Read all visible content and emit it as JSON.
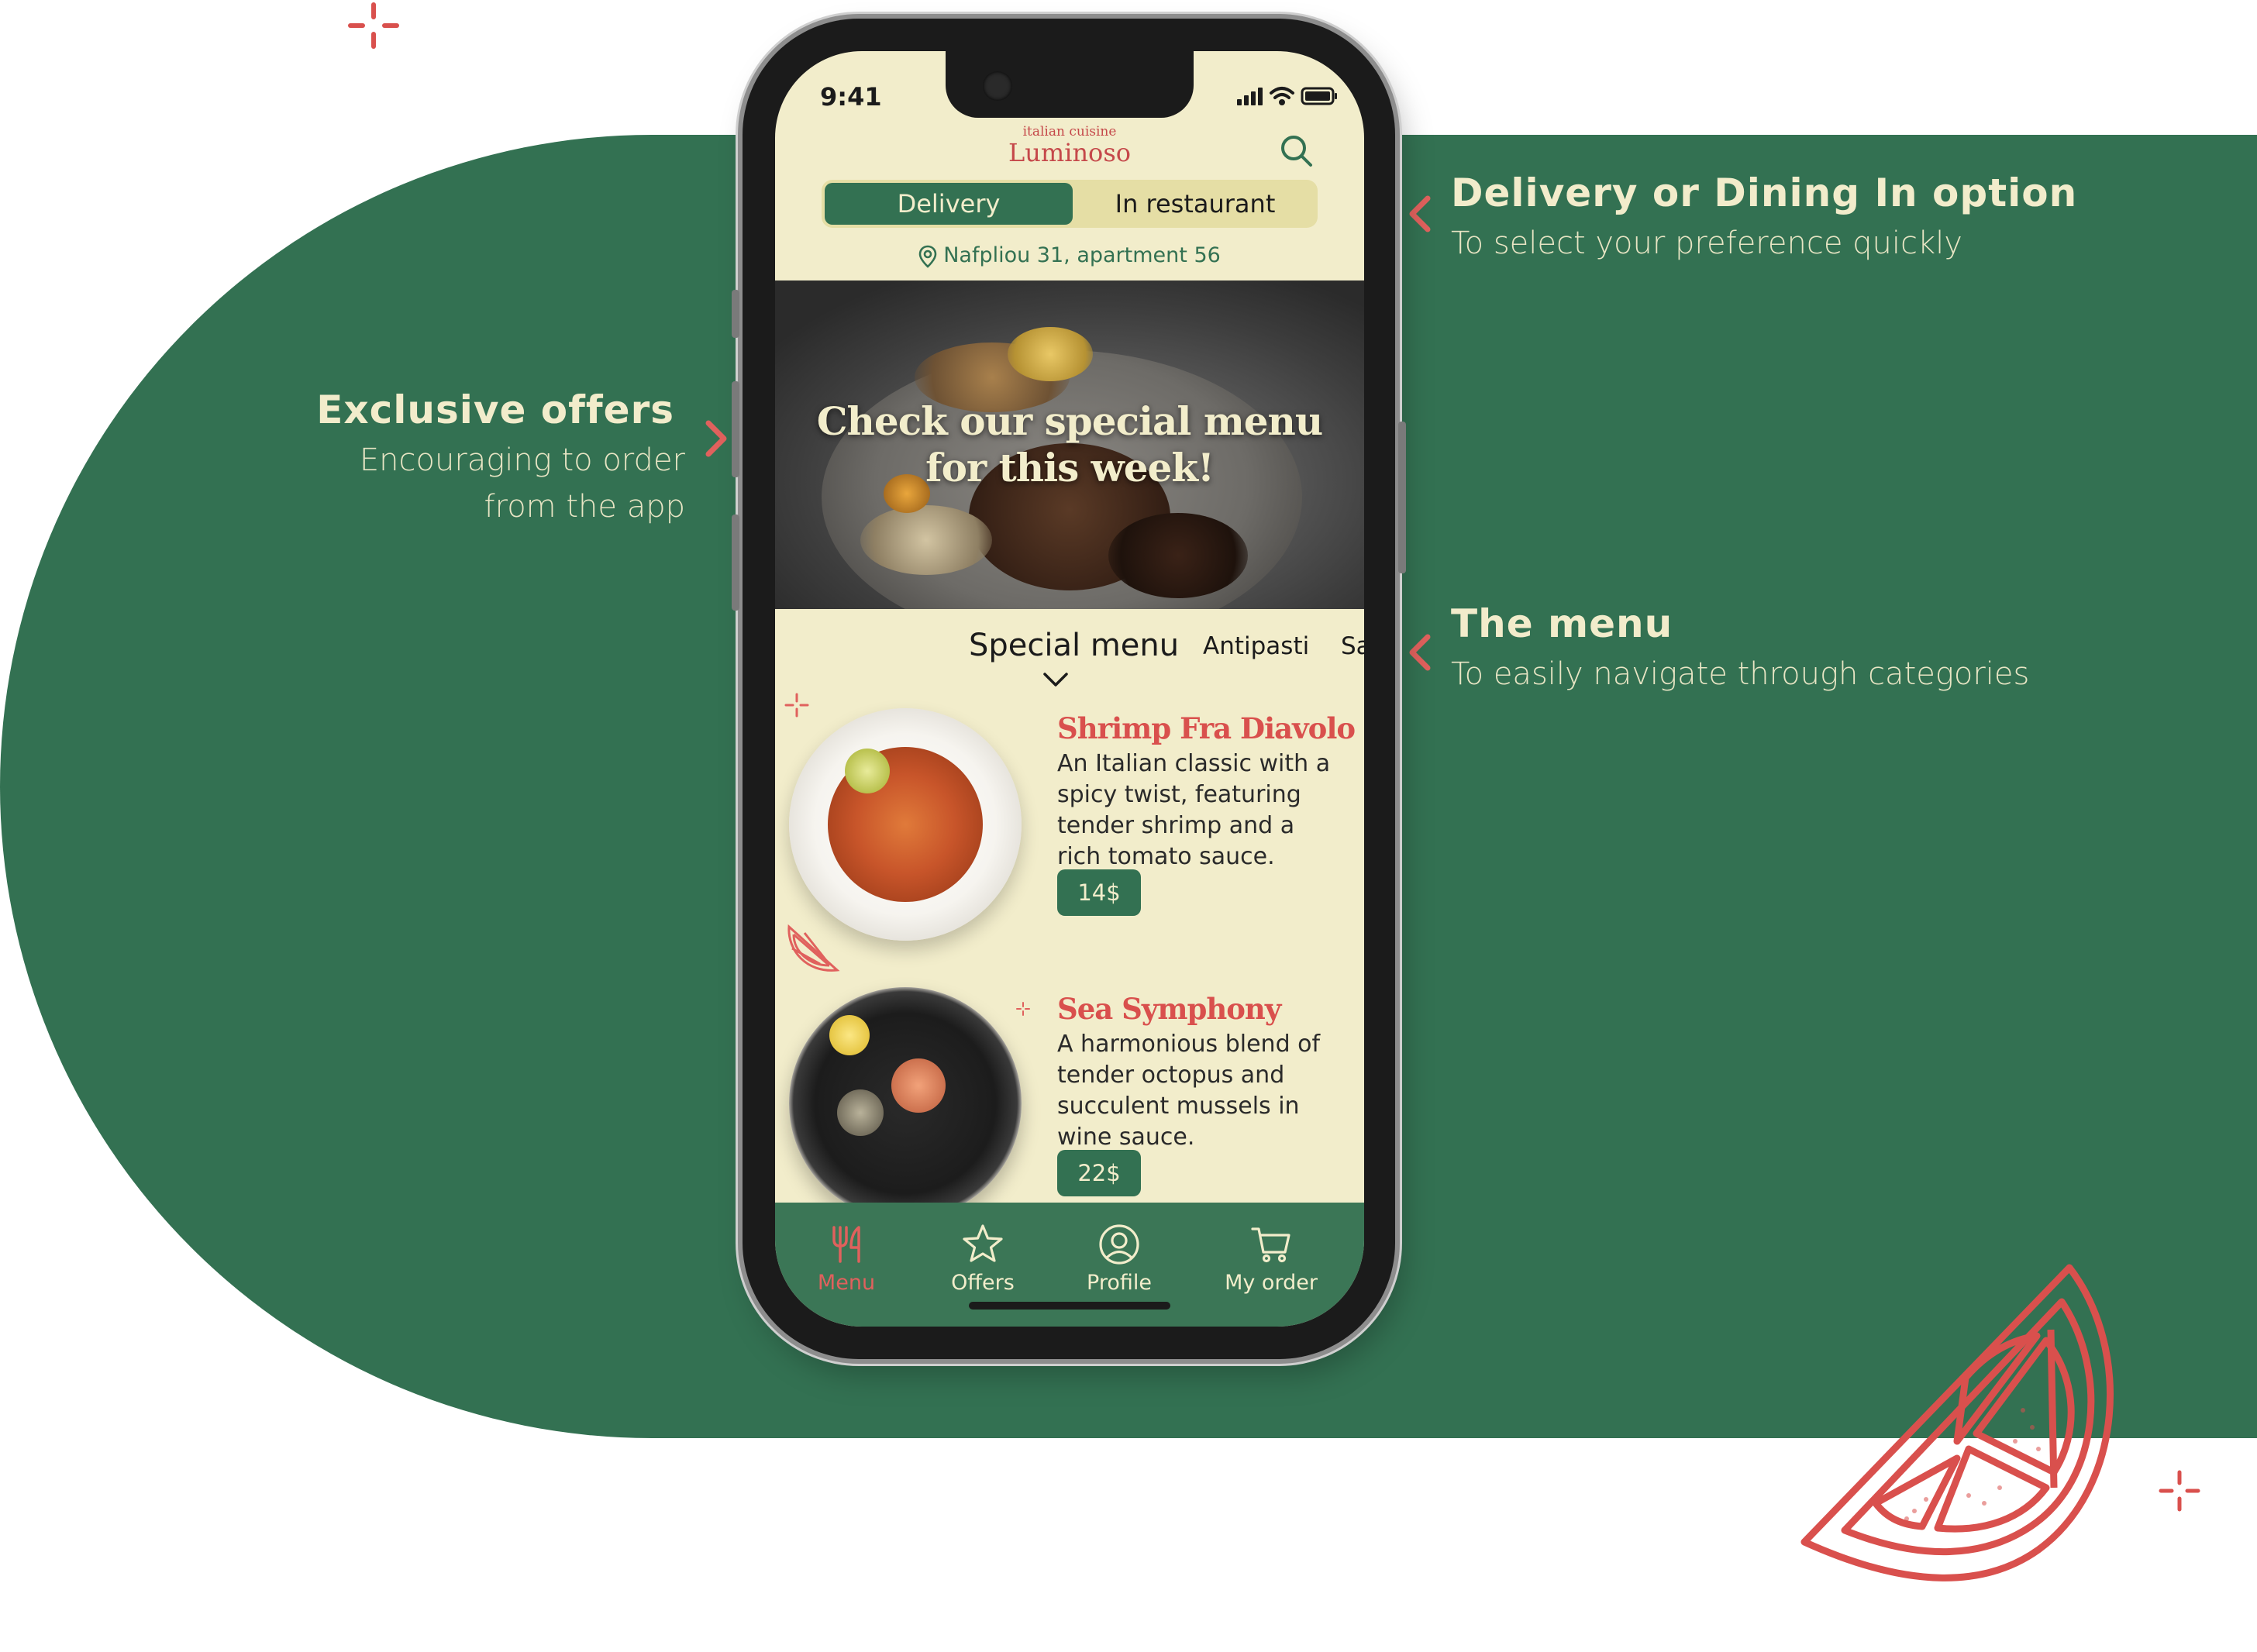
{
  "colors": {
    "brand_green": "#337152",
    "cream": "#f2edcb",
    "accent_red": "#d9504d"
  },
  "annotations": {
    "delivery": {
      "title": "Delivery or Dining In option",
      "subtitle": "To select your preference quickly"
    },
    "offers": {
      "title": "Exclusive offers",
      "subtitle_line1": "Encouraging to order",
      "subtitle_line2": "from the app"
    },
    "menu": {
      "title": "The menu",
      "subtitle": "To easily navigate through categories"
    }
  },
  "phone": {
    "status": {
      "time": "9:41",
      "icons": [
        "signal-icon",
        "wifi-icon",
        "battery-icon"
      ]
    },
    "header": {
      "brand_tagline": "italian cuisine",
      "brand_name": "Luminoso",
      "search_icon": "search-icon"
    },
    "order_mode": {
      "options": [
        "Delivery",
        "In restaurant"
      ],
      "selected": "Delivery"
    },
    "address": {
      "icon": "location-pin-icon",
      "text": "Nafpliou 31, apartment 56"
    },
    "banner": {
      "title_line1": "Check our special menu",
      "title_line2": "for this week!",
      "slides": 3,
      "active_slide": 1
    },
    "categories": {
      "items": [
        "Special menu",
        "Antipasti",
        "Sa"
      ],
      "selected": "Special menu"
    },
    "dishes": [
      {
        "name": "Shrimp Fra Diavolo",
        "description": "An Italian classic with a spicy twist, featuring tender shrimp and a rich tomato sauce.",
        "price": "14$"
      },
      {
        "name": "Sea Symphony",
        "description": "A harmonious blend of tender octopus and succulent mussels in wine sauce.",
        "price": "22$"
      }
    ],
    "tabbar": {
      "items": [
        {
          "label": "Menu",
          "icon": "fork-knife-icon",
          "active": true
        },
        {
          "label": "Offers",
          "icon": "star-icon",
          "active": false
        },
        {
          "label": "Profile",
          "icon": "user-circle-icon",
          "active": false
        },
        {
          "label": "My order",
          "icon": "cart-icon",
          "active": false
        }
      ]
    }
  }
}
